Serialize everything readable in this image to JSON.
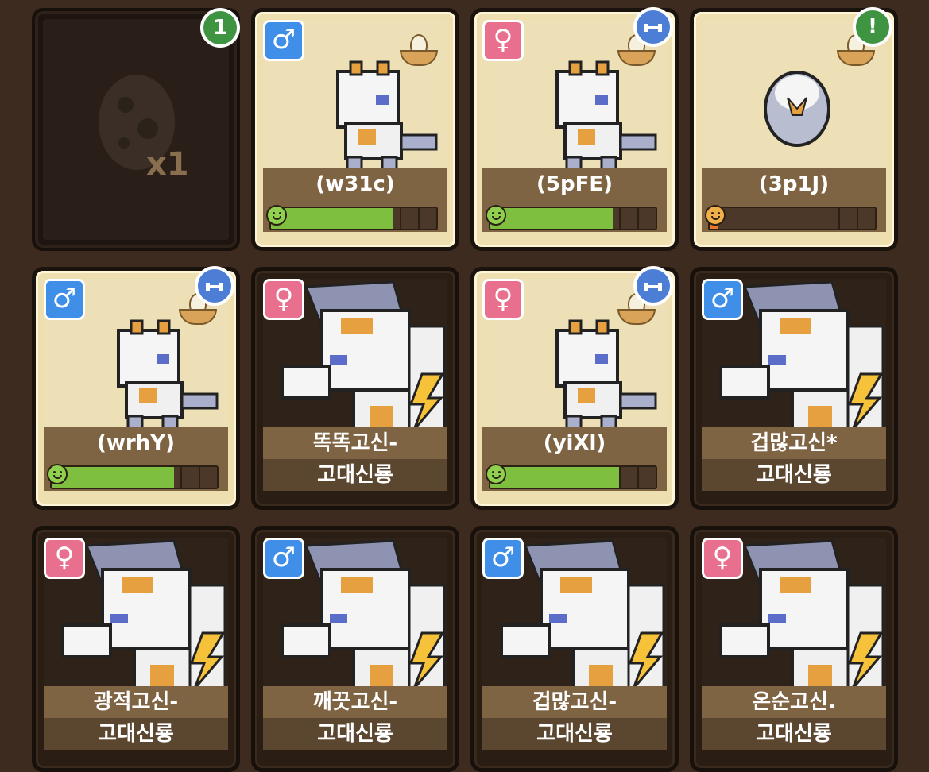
{
  "egg_slot": {
    "count_label": "x1",
    "badge": "1"
  },
  "cards": [
    {
      "id": "w31c",
      "name": "(w31c)",
      "gender_symbol": "♂",
      "gender": "male",
      "stage": "baby",
      "progress": 0.74,
      "nest": true
    },
    {
      "id": "5pFE",
      "name": "(5pFE)",
      "gender_symbol": "♀",
      "gender": "female",
      "stage": "baby",
      "progress": 0.74,
      "nest": true
    },
    {
      "id": "3p1J",
      "name": "(3p1J)",
      "stage": "egg",
      "progress": 0.05,
      "nest": true
    },
    {
      "id": "wrhY",
      "name": "(wrhY)",
      "gender_symbol": "♂",
      "gender": "male",
      "stage": "baby",
      "progress": 0.74,
      "nest": true
    },
    {
      "name": "똑똑고신-",
      "subname": "고대신룡",
      "gender_symbol": "♀",
      "gender": "female",
      "stage": "adult"
    },
    {
      "id": "yiXl",
      "name": "(yiXl)",
      "gender_symbol": "♀",
      "gender": "female",
      "stage": "baby",
      "progress": 0.78,
      "nest": true
    },
    {
      "name": "겁많고신*",
      "subname": "고대신룡",
      "gender_symbol": "♂",
      "gender": "male",
      "stage": "adult"
    },
    {
      "name": "광적고신-",
      "subname": "고대신룡",
      "gender_symbol": "♀",
      "gender": "female",
      "stage": "adult"
    },
    {
      "name": "깨끗고신-",
      "subname": "고대신룡",
      "gender_symbol": "♂",
      "gender": "male",
      "stage": "adult"
    },
    {
      "name": "겁많고신-",
      "subname": "고대신룡",
      "gender_symbol": "♂",
      "gender": "male",
      "stage": "adult"
    },
    {
      "name": "온순고신.",
      "subname": "고대신룡",
      "gender_symbol": "♀",
      "gender": "female",
      "stage": "adult"
    }
  ],
  "badges": {
    "alert": "!",
    "training_icon": "dumbbell-icon"
  },
  "colors": {
    "male": "#3f8ee8",
    "female": "#e8708e",
    "progress_green": "#7fbf3f",
    "progress_orange": "#e57a2e",
    "badge_green": "#3e9440",
    "badge_blue": "#4d7ed6"
  }
}
